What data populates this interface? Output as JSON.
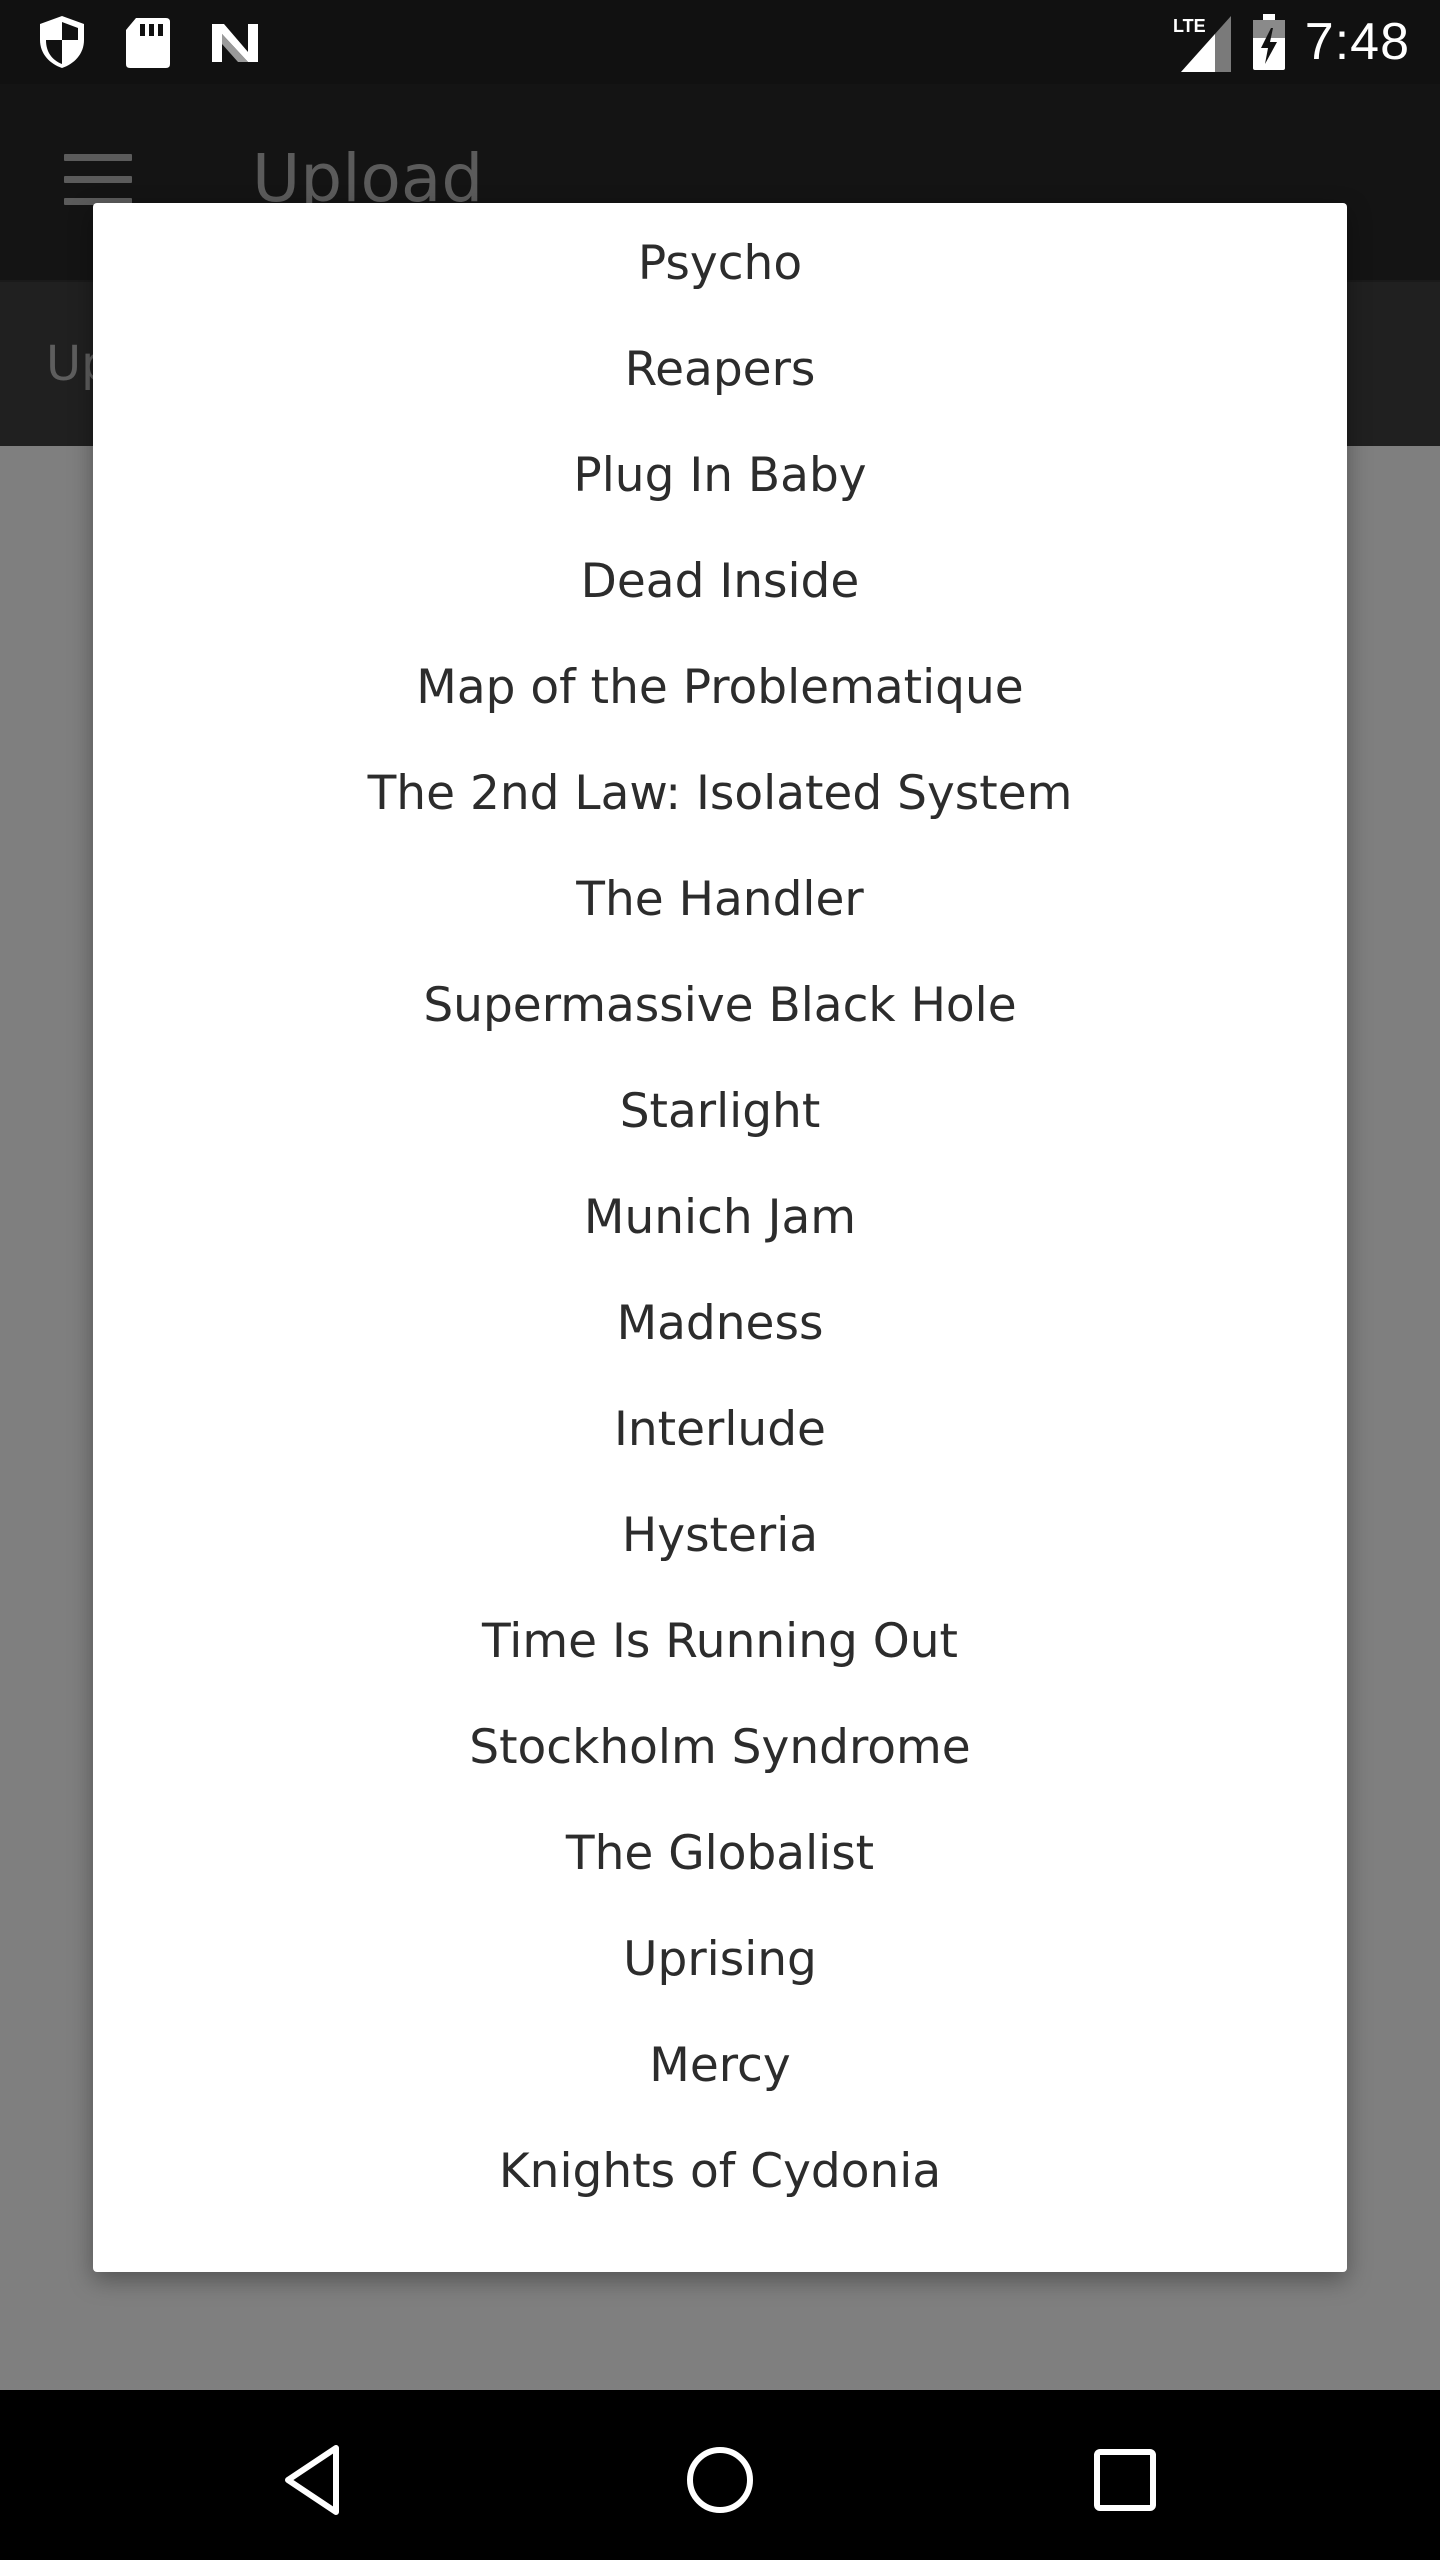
{
  "status_bar": {
    "time": "7:48",
    "network": "LTE",
    "icons": [
      "shield-icon",
      "sd-card-icon",
      "n-logo-icon",
      "signal-icon",
      "battery-charging-icon"
    ]
  },
  "app_bar": {
    "title": "Upload",
    "tab_label": "Up"
  },
  "dialog": {
    "items": [
      "Psycho",
      "Reapers",
      "Plug In Baby",
      "Dead Inside",
      "Map of the Problematique",
      "The 2nd Law: Isolated System",
      "The Handler",
      "Supermassive Black Hole",
      "Starlight",
      "Munich Jam",
      "Madness",
      "Interlude",
      "Hysteria",
      "Time Is Running Out",
      "Stockholm Syndrome",
      "The Globalist",
      "Uprising",
      "Mercy",
      "Knights of Cydonia"
    ]
  },
  "nav_bar": {
    "buttons": [
      "back-icon",
      "home-icon",
      "recents-icon"
    ]
  },
  "colors": {
    "status_bar_bg": "#111111",
    "app_bar_bg": "#141414",
    "scrim": "#7f7f7f",
    "dialog_bg": "#ffffff",
    "item_text": "#2c2c2c",
    "nav_bar_bg": "#000000"
  }
}
